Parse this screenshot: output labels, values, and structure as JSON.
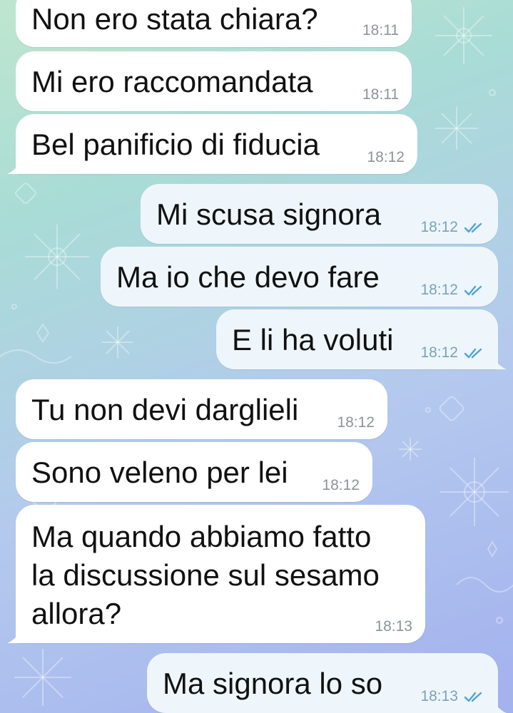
{
  "chat": {
    "messages": [
      {
        "text": "Non ero stata chiara?",
        "time": "18:11",
        "direction": "incoming"
      },
      {
        "text": "Mi ero raccomandata",
        "time": "18:11",
        "direction": "incoming"
      },
      {
        "text": "Bel panificio di fiducia",
        "time": "18:12",
        "direction": "incoming"
      },
      {
        "text": "Mi scusa signora",
        "time": "18:12",
        "direction": "outgoing",
        "status": "read"
      },
      {
        "text": "Ma io che devo fare",
        "time": "18:12",
        "direction": "outgoing",
        "status": "read"
      },
      {
        "text": "E li ha voluti",
        "time": "18:12",
        "direction": "outgoing",
        "status": "read"
      },
      {
        "text": "Tu non devi darglieli",
        "time": "18:12",
        "direction": "incoming"
      },
      {
        "text": "Sono veleno per lei",
        "time": "18:12",
        "direction": "incoming"
      },
      {
        "text": "Ma quando abbiamo fatto\nla discussione sul sesamo\nallora?",
        "time": "18:13",
        "direction": "incoming"
      },
      {
        "text": "Ma signora lo so",
        "time": "18:13",
        "direction": "outgoing",
        "status": "read"
      }
    ]
  },
  "icons": {
    "read_receipt": "double-check-icon",
    "wallpaper": "snowflake-pattern"
  },
  "colors": {
    "incoming_bubble": "#ffffff",
    "outgoing_bubble": "#eef6fb",
    "read_check": "#4fa3d9",
    "time_incoming": "#8d9398",
    "time_outgoing": "#7aa3b8"
  }
}
